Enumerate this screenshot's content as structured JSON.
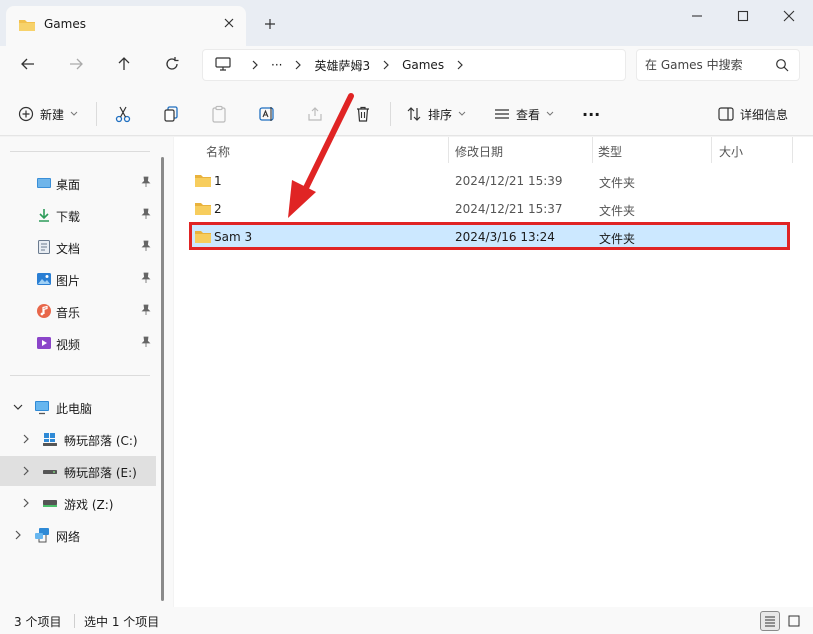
{
  "window": {
    "tab_title": "Games",
    "new_tab_symbol": "+"
  },
  "nav": {
    "breadcrumb_overflow": "···",
    "breadcrumbs": [
      "英雄萨姆3",
      "Games"
    ],
    "search_placeholder": "在 Games 中搜索"
  },
  "toolbar": {
    "new_label": "新建",
    "sort_label": "排序",
    "view_label": "查看",
    "more_label": "···",
    "details_label": "详细信息"
  },
  "sidebar": {
    "quick_access": [
      {
        "label": "桌面",
        "icon": "desktop-icon"
      },
      {
        "label": "下载",
        "icon": "download-icon"
      },
      {
        "label": "文档",
        "icon": "document-icon"
      },
      {
        "label": "图片",
        "icon": "pictures-icon"
      },
      {
        "label": "音乐",
        "icon": "music-icon"
      },
      {
        "label": "视频",
        "icon": "video-icon"
      }
    ],
    "this_pc": "此电脑",
    "drives": [
      {
        "label": "畅玩部落 (C:)",
        "icon": "windows-drive-icon"
      },
      {
        "label": "畅玩部落 (E:)",
        "icon": "drive-icon",
        "selected": true
      },
      {
        "label": "游戏 (Z:)",
        "icon": "drive-icon"
      }
    ],
    "network": "网络"
  },
  "columns": {
    "name": "名称",
    "date": "修改日期",
    "type": "类型",
    "size": "大小"
  },
  "files": [
    {
      "name": "1",
      "date": "2024/12/21 15:39",
      "type": "文件夹",
      "size": ""
    },
    {
      "name": "2",
      "date": "2024/12/21 15:37",
      "type": "文件夹",
      "size": ""
    },
    {
      "name": "Sam 3",
      "date": "2024/3/16 13:24",
      "type": "文件夹",
      "size": "",
      "selected": true
    }
  ],
  "status": {
    "count": "3 个项目",
    "selected": "选中 1 个项目"
  },
  "colors": {
    "accent": "#0067c0",
    "selection": "#cce8ff",
    "annotation": "#e02424",
    "folder": "#f2c14e"
  }
}
